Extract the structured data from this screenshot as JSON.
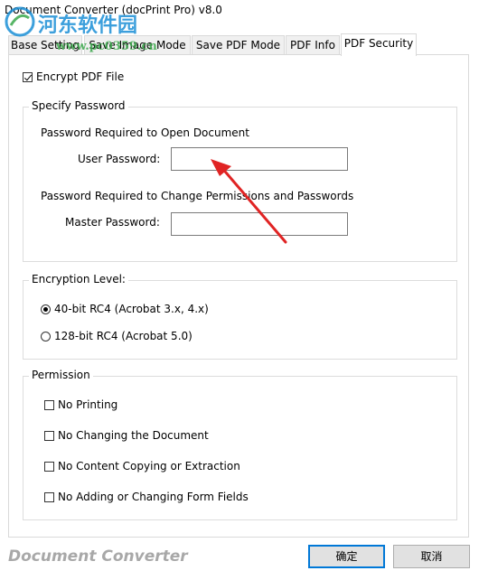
{
  "window": {
    "title": "Document Converter (docPrint Pro) v8.0"
  },
  "watermark": {
    "text": "河东软件园",
    "url": "www.pc0359.cn"
  },
  "tabs": [
    {
      "label": "Base Setting"
    },
    {
      "label": "Save Image Mode"
    },
    {
      "label": "Save PDF Mode"
    },
    {
      "label": "PDF Info"
    },
    {
      "label": "PDF Security"
    }
  ],
  "security": {
    "encrypt_label": "Encrypt PDF File",
    "encrypt_checked": true,
    "password_group": {
      "legend": "Specify Password",
      "open_heading": "Password Required to Open Document",
      "user_password_label": "User Password:",
      "user_password_value": "",
      "permissions_heading": "Password Required to Change Permissions and Passwords",
      "master_password_label": "Master Password:",
      "master_password_value": ""
    },
    "encryption_group": {
      "legend": "Encryption Level:",
      "options": [
        {
          "label": "40-bit RC4 (Acrobat 3.x, 4.x)",
          "selected": true
        },
        {
          "label": "128-bit RC4 (Acrobat 5.0)",
          "selected": false
        }
      ]
    },
    "permission_group": {
      "legend": "Permission",
      "items": [
        {
          "label": "No Printing",
          "checked": false
        },
        {
          "label": "No Changing the Document",
          "checked": false
        },
        {
          "label": "No Content Copying or Extraction",
          "checked": false
        },
        {
          "label": "No Adding or Changing Form Fields",
          "checked": false
        }
      ]
    }
  },
  "footer": {
    "brand": "Document Converter",
    "ok_label": "确定",
    "cancel_label": "取消"
  },
  "colors": {
    "watermark_blue": "#1b8fd6",
    "watermark_green": "#3aa84b",
    "arrow_red": "#e02424",
    "accent": "#0078d7"
  }
}
